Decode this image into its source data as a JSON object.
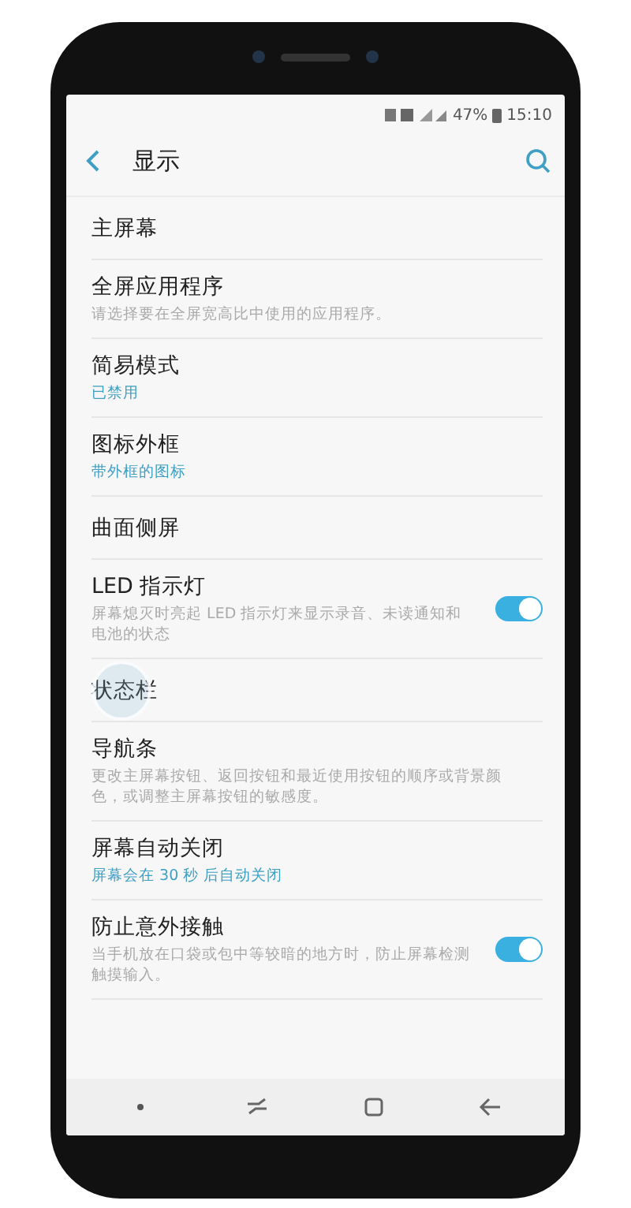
{
  "status_bar": {
    "battery": "47%",
    "time": "15:10"
  },
  "header": {
    "title": "显示"
  },
  "items": [
    {
      "title": "主屏幕"
    },
    {
      "title": "全屏应用程序",
      "description": "请选择要在全屏宽高比中使用的应用程序。"
    },
    {
      "title": "简易模式",
      "value": "已禁用"
    },
    {
      "title": "图标外框",
      "value": "带外框的图标"
    },
    {
      "title": "曲面侧屏"
    },
    {
      "title": "LED 指示灯",
      "description": "屏幕熄灭时亮起 LED 指示灯来显示录音、未读通知和电池的状态",
      "on": true
    },
    {
      "title": "状态栏",
      "touched": true
    },
    {
      "title": "导航条",
      "description": "更改主屏幕按钮、返回按钮和最近使用按钮的顺序或背景颜色，或调整主屏幕按钮的敏感度。"
    },
    {
      "title": "屏幕自动关闭",
      "value": "屏幕会在 30 秒 后自动关闭"
    },
    {
      "title": "防止意外接触",
      "description": "当手机放在口袋或包中等较暗的地方时，防止屏幕检测触摸输入。",
      "on": true
    }
  ]
}
